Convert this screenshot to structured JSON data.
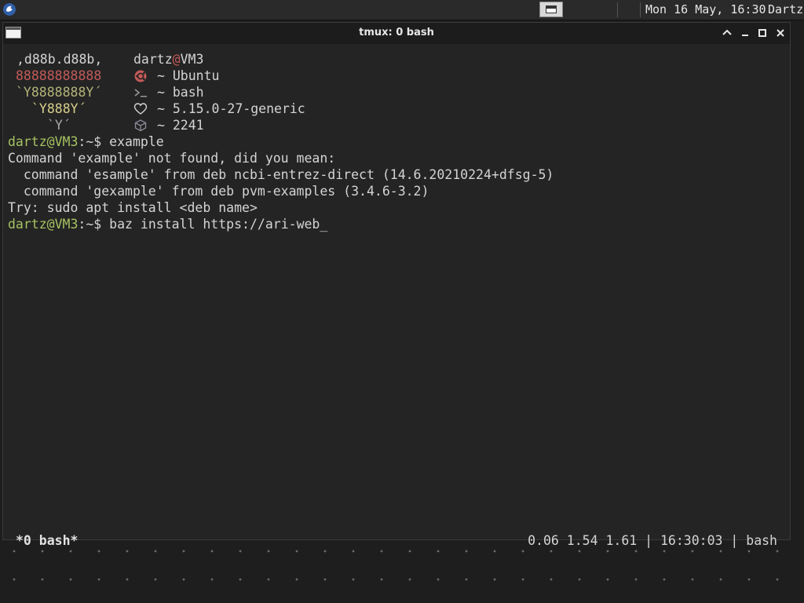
{
  "panel": {
    "clock": "Mon 16 May, 16:30",
    "user": "Dartz",
    "logo_icon": "distro-logo-icon",
    "taskbutton_icon": "window-icon"
  },
  "window": {
    "title": "tmux: 0 bash",
    "buttons": [
      "shade-icon",
      "minimize-icon",
      "maximize-icon",
      "close-icon"
    ]
  },
  "fetch": {
    "art": [
      ",d88b.d88b,",
      "88888888888",
      "`Y8888888Y´",
      "`Y888Y´",
      "`Y´"
    ],
    "user": "dartz",
    "at": "@",
    "host": "VM3",
    "rows": [
      {
        "icon": "ubuntu-icon",
        "text": "~ Ubuntu"
      },
      {
        "icon": "terminal-prompt-icon",
        "text": "~ bash"
      },
      {
        "icon": "heart-icon",
        "text": "~ 5.15.0-27-generic"
      },
      {
        "icon": "package-icon",
        "text": "~ 2241"
      }
    ]
  },
  "terminal": {
    "prompt_user": "dartz@VM3",
    "prompt_suffix": ":~$ ",
    "command1": "example",
    "output": [
      "Command 'example' not found, did you mean:",
      "  command 'esample' from deb ncbi-entrez-direct (14.6.20210224+dfsg-5)",
      "  command 'gexample' from deb pvm-examples (3.4.6-3.2)",
      "Try: sudo apt install <deb name>"
    ],
    "command2": "baz install https://ari-web",
    "cursor": "_"
  },
  "statusbar": {
    "window": "*0 bash*",
    "right": "0.06 1.54 1.61 | 16:30:03 | bash"
  },
  "colors": {
    "prompt": "#a5c261",
    "heart_red": "#c45a5a",
    "background": "#242424"
  }
}
